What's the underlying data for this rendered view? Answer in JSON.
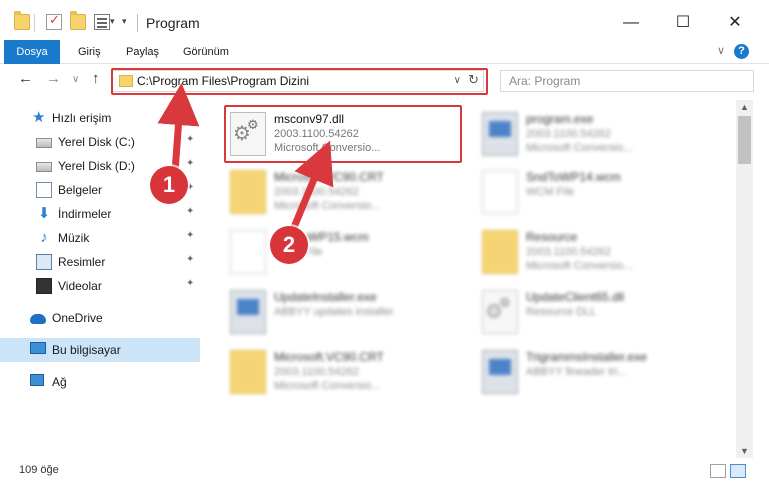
{
  "window": {
    "title": "Program",
    "minimize_glyph": "—",
    "maximize_glyph": "☐",
    "close_glyph": "✕"
  },
  "ribbon": {
    "tabs": [
      {
        "label": "Dosya",
        "active": true
      },
      {
        "label": "Giriş"
      },
      {
        "label": "Paylaş"
      },
      {
        "label": "Görünüm"
      }
    ],
    "expand_glyph": "∨",
    "help_glyph": "?"
  },
  "navigation": {
    "back_glyph": "←",
    "forward_glyph": "→",
    "recent_glyph": "∨",
    "up_glyph": "↑",
    "address": "C:\\Program Files\\Program Dizini",
    "address_drop_glyph": "∨",
    "refresh_glyph": "↻",
    "search_placeholder": "Ara: Program"
  },
  "sidebar": {
    "items": [
      {
        "label": "Hızlı erişim",
        "icon": "star-icon",
        "pinned": false
      },
      {
        "label": "Yerel Disk (C:)",
        "icon": "disk-icon",
        "pinned": true
      },
      {
        "label": "Yerel Disk (D:)",
        "icon": "disk-icon",
        "pinned": true
      },
      {
        "label": "Belgeler",
        "icon": "documents-icon",
        "pinned": true
      },
      {
        "label": "İndirmeler",
        "icon": "download-icon",
        "pinned": true
      },
      {
        "label": "Müzik",
        "icon": "music-icon",
        "pinned": true
      },
      {
        "label": "Resimler",
        "icon": "pictures-icon",
        "pinned": true
      },
      {
        "label": "Videolar",
        "icon": "videos-icon",
        "pinned": true
      },
      {
        "label": "OneDrive",
        "icon": "onedrive-icon",
        "pinned": false
      },
      {
        "label": "Bu bilgisayar",
        "icon": "this-pc-icon",
        "pinned": false,
        "selected": true
      },
      {
        "label": "Ağ",
        "icon": "network-icon",
        "pinned": false
      }
    ],
    "pin_glyph": "📌"
  },
  "files": {
    "highlighted": {
      "name": "msconv97.dll",
      "version": "2003.1100.54262",
      "desc": "Microsoft Conversio..."
    },
    "others": [
      {
        "name": "program.exe",
        "line2": "2003.1100.54262",
        "line3": "Microsoft Conversio..."
      },
      {
        "name": "Microsoft.VC90.CRT",
        "line2": "2003.1100.54262",
        "line3": "Microsoft Conversio..."
      },
      {
        "name": "SndToWP14.wcm",
        "line2": "WCM File",
        "line3": ""
      },
      {
        "name": "SndToWP15.wcm",
        "line2": "WCM File",
        "line3": ""
      },
      {
        "name": "Resource",
        "line2": "2003.1100.54262",
        "line3": "Microsoft Conversio..."
      },
      {
        "name": "UpdateInstaller.exe",
        "line2": "ABBYY updates installer",
        "line3": ""
      },
      {
        "name": "UpdateClient65.dll",
        "line2": "Resource DLL",
        "line3": ""
      },
      {
        "name": "Microsoft.VC90.CRT",
        "line2": "2003.1100.54262",
        "line3": "Microsoft Conversio..."
      },
      {
        "name": "TrigrammsInstaller.exe",
        "line2": "ABBYY fineader tri...",
        "line3": ""
      }
    ]
  },
  "annotations": {
    "step1": "1",
    "step2": "2",
    "accent_color": "#d9383c"
  },
  "statusbar": {
    "item_count": "109 öğe"
  },
  "colors": {
    "ribbon_file_tab": "#1979ca",
    "selection": "#cce4f7"
  }
}
